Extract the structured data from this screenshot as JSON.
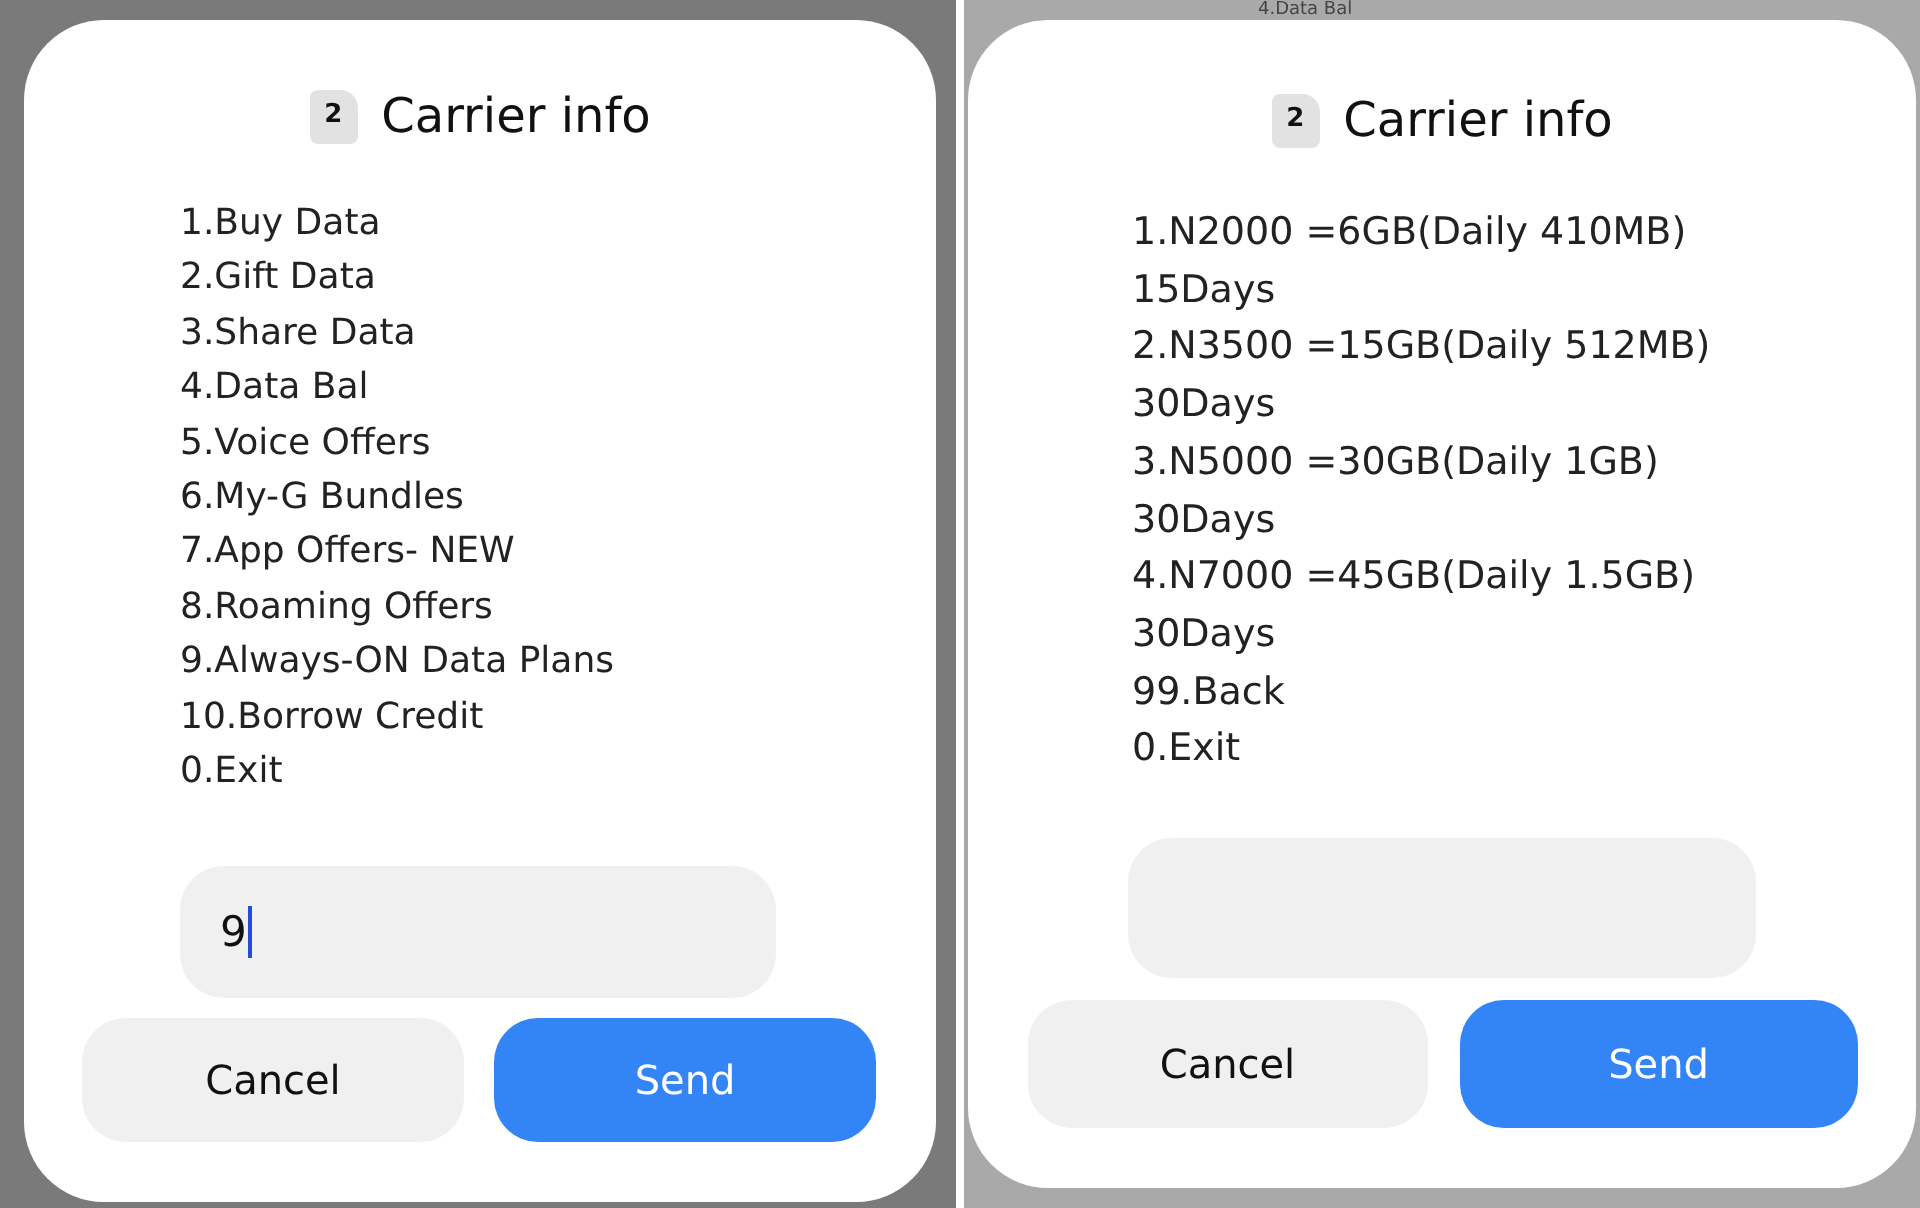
{
  "screens": [
    {
      "dialog": {
        "sim_badge": "2",
        "title": "Carrier info",
        "message_lines": [
          "1.Buy Data",
          "2.Gift Data",
          "3.Share Data",
          "4.Data Bal",
          "5.Voice Offers",
          "6.My-G Bundles",
          "7.App Offers- NEW",
          "8.Roaming Offers",
          "9.Always-ON Data Plans",
          "10.Borrow Credit",
          "0.Exit"
        ],
        "input": {
          "value": "9",
          "focused": true
        },
        "buttons": [
          {
            "label": "Cancel",
            "kind": "secondary"
          },
          {
            "label": "Send",
            "kind": "primary"
          }
        ]
      }
    },
    {
      "background_text": "4.Data Bal",
      "dialog": {
        "sim_badge": "2",
        "title": "Carrier info",
        "message_lines": [
          "1.N2000 =6GB(Daily 410MB)",
          "15Days",
          "2.N3500 =15GB(Daily 512MB)",
          "30Days",
          "3.N5000 =30GB(Daily 1GB)",
          "30Days",
          "4.N7000 =45GB(Daily 1.5GB)",
          "30Days",
          "99.Back",
          "0.Exit"
        ],
        "input": {
          "focused": false
        },
        "buttons": [
          {
            "label": "Cancel",
            "kind": "secondary"
          },
          {
            "label": "Send",
            "kind": "primary"
          }
        ]
      }
    }
  ]
}
